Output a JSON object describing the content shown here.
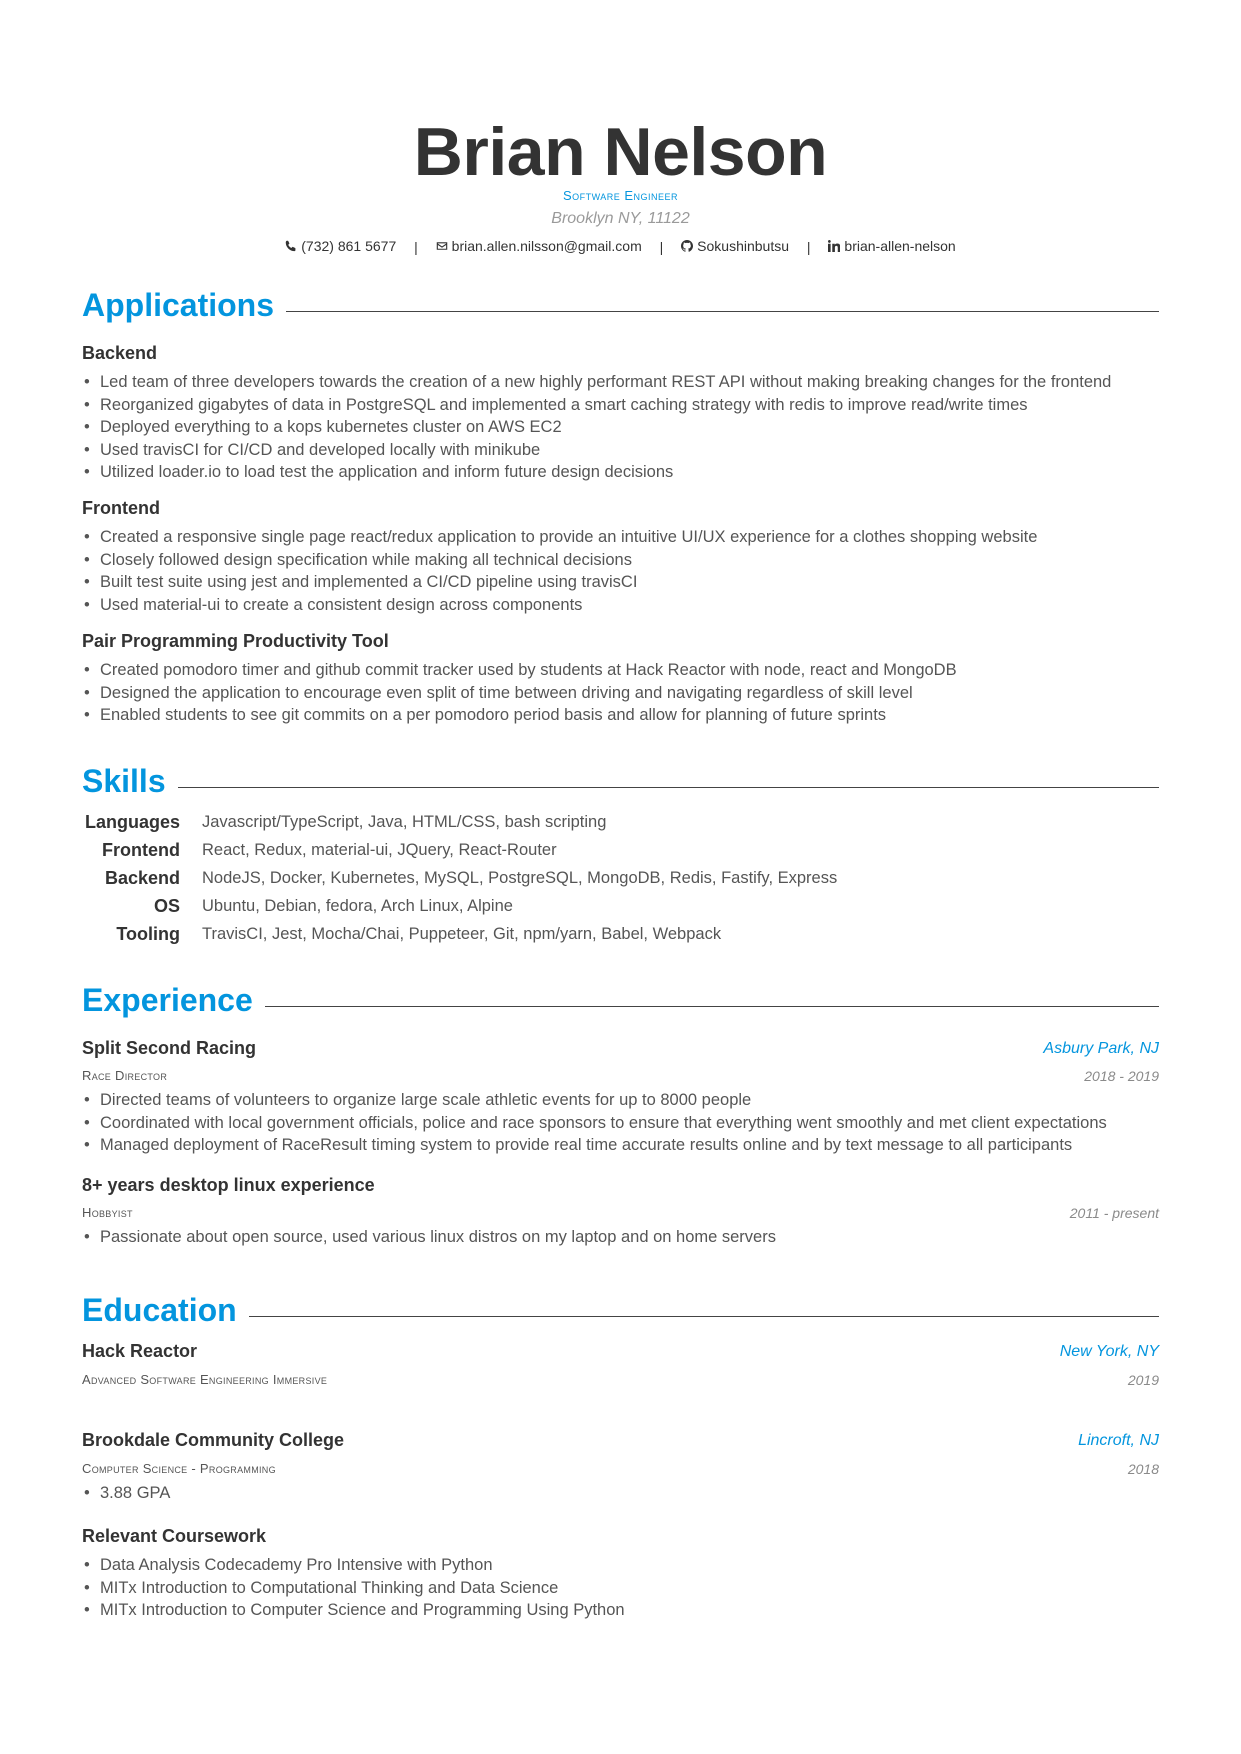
{
  "header": {
    "name": "Brian Nelson",
    "position": "Software Engineer",
    "address": "Brooklyn NY, 11122",
    "contacts": {
      "phone": "(732) 861 5677",
      "email": "brian.allen.nilsson@gmail.com",
      "github": "Sokushinbutsu",
      "linkedin": "brian-allen-nelson",
      "separator": "|"
    }
  },
  "applications": {
    "title": "Applications",
    "entries": [
      {
        "name": "Backend",
        "items": [
          "Led team of three developers towards the creation of a new highly performant REST API without making breaking changes for the frontend",
          "Reorganized gigabytes of data in PostgreSQL and implemented a smart caching strategy with redis to improve read/write times",
          "Deployed everything to a kops kubernetes cluster on AWS EC2",
          "Used travisCI for CI/CD and developed locally with minikube",
          "Utilized loader.io to load test the application and inform future design decisions"
        ]
      },
      {
        "name": "Frontend",
        "items": [
          "Created a responsive single page react/redux application to provide an intuitive UI/UX experience for a clothes shopping website",
          "Closely followed design specification while making all technical decisions",
          "Built test suite using jest and implemented a CI/CD pipeline using travisCI",
          "Used material-ui to create a consistent design across components"
        ]
      },
      {
        "name": "Pair Programming Productivity Tool",
        "items": [
          "Created pomodoro timer and github commit tracker used by students at Hack Reactor with node, react and MongoDB",
          "Designed the application to encourage even split of time between driving and navigating regardless of skill level",
          "Enabled students to see git commits on a per pomodoro period basis and allow for planning of future sprints"
        ]
      }
    ]
  },
  "skills": {
    "title": "Skills",
    "rows": [
      {
        "category": "Languages",
        "list": "Javascript/TypeScript, Java, HTML/CSS, bash scripting"
      },
      {
        "category": "Frontend",
        "list": "React, Redux, material-ui, JQuery, React-Router"
      },
      {
        "category": "Backend",
        "list": "NodeJS, Docker, Kubernetes, MySQL, PostgreSQL, MongoDB, Redis, Fastify, Express"
      },
      {
        "category": "OS",
        "list": "Ubuntu, Debian, fedora, Arch Linux, Alpine"
      },
      {
        "category": "Tooling",
        "list": "TravisCI, Jest, Mocha/Chai, Puppeteer, Git, npm/yarn, Babel, Webpack"
      }
    ]
  },
  "experience": {
    "title": "Experience",
    "entries": [
      {
        "organization": "Split Second Racing",
        "location": "Asbury Park, NJ",
        "role": "Race Director",
        "date": "2018 - 2019",
        "items": [
          "Directed teams of volunteers to organize large scale athletic events for up to 8000 people",
          "Coordinated with local government officials, police and race sponsors to ensure that everything went smoothly and met client expectations",
          "Managed deployment of RaceResult timing system to provide real time accurate results online and by text message to all participants"
        ]
      },
      {
        "organization": "8+ years desktop linux experience",
        "location": "",
        "role": "Hobbyist",
        "date": "2011 - present",
        "items": [
          "Passionate about open source, used various linux distros on my laptop and on home servers"
        ]
      }
    ]
  },
  "education": {
    "title": "Education",
    "entries": [
      {
        "school": "Hack Reactor",
        "location": "New York, NY",
        "degree": "Advanced Software Engineering Immersive",
        "date": "2019",
        "items": []
      },
      {
        "school": "Brookdale Community College",
        "location": "Lincroft, NJ",
        "degree": "Computer Science - Programming",
        "date": "2018",
        "items": [
          "3.88 GPA"
        ]
      }
    ],
    "coursework": {
      "title": "Relevant Coursework",
      "items": [
        "Data Analysis Codecademy Pro Intensive with Python",
        "MITx Introduction to Computational Thinking and Data Science",
        "MITx Introduction to Computer Science and Programming Using Python"
      ]
    }
  },
  "bullet_char": "•",
  "accent_color": "#0395DE"
}
